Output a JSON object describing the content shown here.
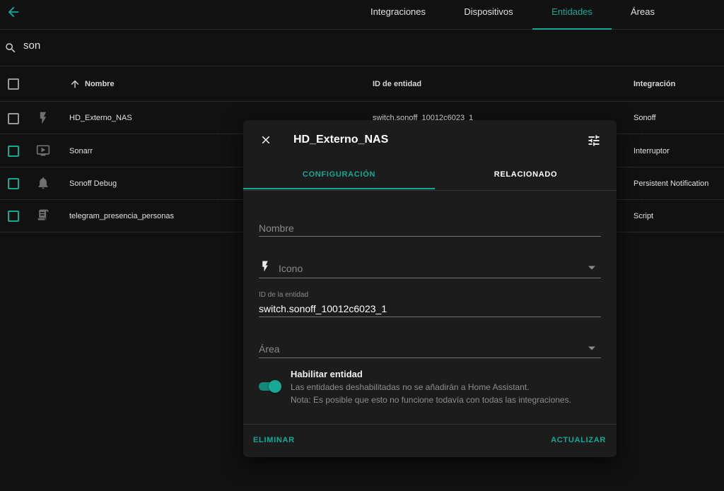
{
  "colors": {
    "accent": "#13a894",
    "background": "#111111",
    "dialog": "#1c1c1c"
  },
  "header": {
    "tabs": [
      {
        "label": "Integraciones",
        "active": false
      },
      {
        "label": "Dispositivos",
        "active": false
      },
      {
        "label": "Entidades",
        "active": true
      },
      {
        "label": "Áreas",
        "active": false
      }
    ]
  },
  "search": {
    "value": "son",
    "icon": "search-icon"
  },
  "table": {
    "columns": {
      "name": "Nombre",
      "entity_id": "ID de entidad",
      "integration": "Integración"
    },
    "rows": [
      {
        "icon": "flash-icon",
        "name": "HD_Externo_NAS",
        "entity_id": "switch.sonoff_10012c6023_1",
        "integration": "Sonoff"
      },
      {
        "icon": "youtube-tv-icon",
        "name": "Sonarr",
        "entity_id": "",
        "integration": "Interruptor"
      },
      {
        "icon": "bell-icon",
        "name": "Sonoff Debug",
        "entity_id": "",
        "integration": "Persistent Notification"
      },
      {
        "icon": "script-text-icon",
        "name": "telegram_presencia_personas",
        "entity_id": "",
        "integration": "Script"
      }
    ]
  },
  "dialog": {
    "title": "HD_Externo_NAS",
    "tabs": [
      {
        "label": "CONFIGURACIÓN",
        "active": true
      },
      {
        "label": "RELACIONADO",
        "active": false
      }
    ],
    "fields": {
      "name_placeholder": "Nombre",
      "icon_placeholder": "Icono",
      "entity_id_label": "ID de la entidad",
      "entity_id_value": "switch.sonoff_10012c6023_1",
      "area_placeholder": "Área"
    },
    "enable": {
      "enabled": true,
      "title": "Habilitar entidad",
      "desc1": "Las entidades deshabilitadas no se añadirán a Home Assistant.",
      "desc2": "Nota: Es posible que esto no funcione todavía con todas las integraciones."
    },
    "buttons": {
      "delete": "ELIMINAR",
      "update": "ACTUALIZAR"
    }
  }
}
